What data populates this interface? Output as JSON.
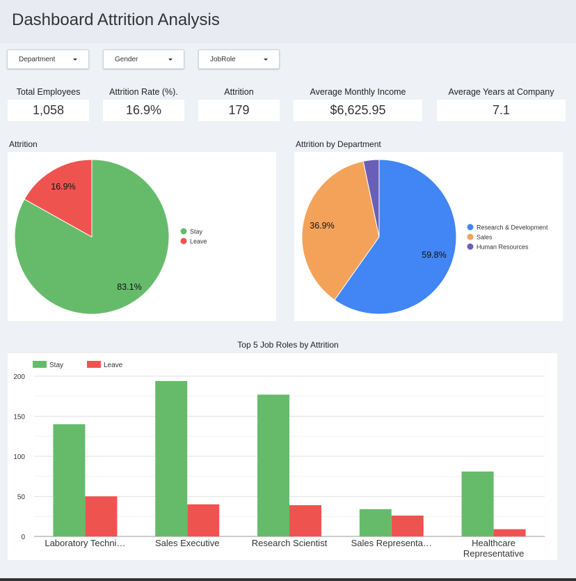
{
  "header": {
    "title": "Dashboard Attrition Analysis"
  },
  "filters": [
    {
      "label": "Department"
    },
    {
      "label": "Gender"
    },
    {
      "label": "JobRole"
    }
  ],
  "kpis": [
    {
      "label": "Total Employees",
      "value": "1,058"
    },
    {
      "label": "Attrition Rate (%).",
      "value": "16.9%"
    },
    {
      "label": "Attrition",
      "value": "179"
    },
    {
      "label": "Average Monthly Income",
      "value": "$6,625.95"
    },
    {
      "label": "Average Years at Company",
      "value": "7.1"
    }
  ],
  "sections": {
    "attrition": "Attrition",
    "by_department": "Attrition by Department"
  },
  "colors": {
    "stay": "#66bb6a",
    "leave": "#ef5350",
    "rnd": "#4285f4",
    "sales": "#f4a259",
    "hr": "#6a5fb8"
  },
  "chart_data": [
    {
      "type": "pie",
      "title": "",
      "labels": [
        "Stay",
        "Leave"
      ],
      "values": [
        83.1,
        16.9
      ],
      "data_labels": [
        "83.1%",
        "16.9%"
      ],
      "colors": [
        "#66bb6a",
        "#ef5350"
      ],
      "legend": "right"
    },
    {
      "type": "pie",
      "title": "",
      "labels": [
        "Research & Development",
        "Sales",
        "Human Resources"
      ],
      "values": [
        59.8,
        36.9,
        3.3
      ],
      "data_labels": [
        "59.8%",
        "36.9%",
        ""
      ],
      "colors": [
        "#4285f4",
        "#f4a259",
        "#6a5fb8"
      ],
      "legend": "right"
    },
    {
      "type": "bar",
      "title": "Top 5 Job Roles by Attrition",
      "categories": [
        "Laboratory Techni…",
        "Sales Executive",
        "Research Scientist",
        "Sales Representa…",
        "Healthcare Representative"
      ],
      "series": [
        {
          "name": "Stay",
          "values": [
            140,
            194,
            177,
            34,
            81
          ],
          "color": "#66bb6a"
        },
        {
          "name": "Leave",
          "values": [
            50,
            40,
            39,
            26,
            9
          ],
          "color": "#ef5350"
        }
      ],
      "yticks": [
        "0",
        "50",
        "100",
        "150",
        "200"
      ],
      "ylim": [
        0,
        200
      ],
      "grid": true,
      "legend": "top-left"
    }
  ]
}
